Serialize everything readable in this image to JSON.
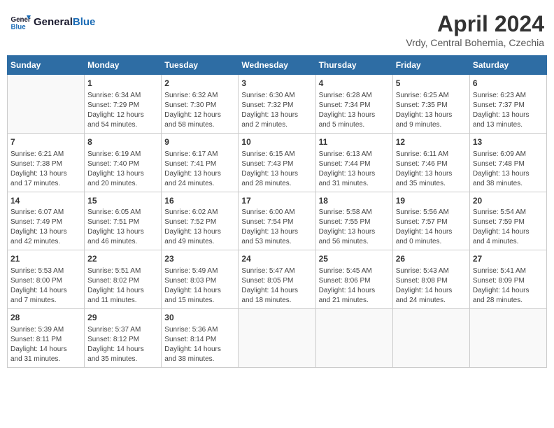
{
  "header": {
    "logo_line1": "General",
    "logo_line2": "Blue",
    "month": "April 2024",
    "location": "Vrdy, Central Bohemia, Czechia"
  },
  "days_of_week": [
    "Sunday",
    "Monday",
    "Tuesday",
    "Wednesday",
    "Thursday",
    "Friday",
    "Saturday"
  ],
  "weeks": [
    [
      {
        "num": "",
        "info": ""
      },
      {
        "num": "1",
        "info": "Sunrise: 6:34 AM\nSunset: 7:29 PM\nDaylight: 12 hours\nand 54 minutes."
      },
      {
        "num": "2",
        "info": "Sunrise: 6:32 AM\nSunset: 7:30 PM\nDaylight: 12 hours\nand 58 minutes."
      },
      {
        "num": "3",
        "info": "Sunrise: 6:30 AM\nSunset: 7:32 PM\nDaylight: 13 hours\nand 2 minutes."
      },
      {
        "num": "4",
        "info": "Sunrise: 6:28 AM\nSunset: 7:34 PM\nDaylight: 13 hours\nand 5 minutes."
      },
      {
        "num": "5",
        "info": "Sunrise: 6:25 AM\nSunset: 7:35 PM\nDaylight: 13 hours\nand 9 minutes."
      },
      {
        "num": "6",
        "info": "Sunrise: 6:23 AM\nSunset: 7:37 PM\nDaylight: 13 hours\nand 13 minutes."
      }
    ],
    [
      {
        "num": "7",
        "info": "Sunrise: 6:21 AM\nSunset: 7:38 PM\nDaylight: 13 hours\nand 17 minutes."
      },
      {
        "num": "8",
        "info": "Sunrise: 6:19 AM\nSunset: 7:40 PM\nDaylight: 13 hours\nand 20 minutes."
      },
      {
        "num": "9",
        "info": "Sunrise: 6:17 AM\nSunset: 7:41 PM\nDaylight: 13 hours\nand 24 minutes."
      },
      {
        "num": "10",
        "info": "Sunrise: 6:15 AM\nSunset: 7:43 PM\nDaylight: 13 hours\nand 28 minutes."
      },
      {
        "num": "11",
        "info": "Sunrise: 6:13 AM\nSunset: 7:44 PM\nDaylight: 13 hours\nand 31 minutes."
      },
      {
        "num": "12",
        "info": "Sunrise: 6:11 AM\nSunset: 7:46 PM\nDaylight: 13 hours\nand 35 minutes."
      },
      {
        "num": "13",
        "info": "Sunrise: 6:09 AM\nSunset: 7:48 PM\nDaylight: 13 hours\nand 38 minutes."
      }
    ],
    [
      {
        "num": "14",
        "info": "Sunrise: 6:07 AM\nSunset: 7:49 PM\nDaylight: 13 hours\nand 42 minutes."
      },
      {
        "num": "15",
        "info": "Sunrise: 6:05 AM\nSunset: 7:51 PM\nDaylight: 13 hours\nand 46 minutes."
      },
      {
        "num": "16",
        "info": "Sunrise: 6:02 AM\nSunset: 7:52 PM\nDaylight: 13 hours\nand 49 minutes."
      },
      {
        "num": "17",
        "info": "Sunrise: 6:00 AM\nSunset: 7:54 PM\nDaylight: 13 hours\nand 53 minutes."
      },
      {
        "num": "18",
        "info": "Sunrise: 5:58 AM\nSunset: 7:55 PM\nDaylight: 13 hours\nand 56 minutes."
      },
      {
        "num": "19",
        "info": "Sunrise: 5:56 AM\nSunset: 7:57 PM\nDaylight: 14 hours\nand 0 minutes."
      },
      {
        "num": "20",
        "info": "Sunrise: 5:54 AM\nSunset: 7:59 PM\nDaylight: 14 hours\nand 4 minutes."
      }
    ],
    [
      {
        "num": "21",
        "info": "Sunrise: 5:53 AM\nSunset: 8:00 PM\nDaylight: 14 hours\nand 7 minutes."
      },
      {
        "num": "22",
        "info": "Sunrise: 5:51 AM\nSunset: 8:02 PM\nDaylight: 14 hours\nand 11 minutes."
      },
      {
        "num": "23",
        "info": "Sunrise: 5:49 AM\nSunset: 8:03 PM\nDaylight: 14 hours\nand 15 minutes."
      },
      {
        "num": "24",
        "info": "Sunrise: 5:47 AM\nSunset: 8:05 PM\nDaylight: 14 hours\nand 18 minutes."
      },
      {
        "num": "25",
        "info": "Sunrise: 5:45 AM\nSunset: 8:06 PM\nDaylight: 14 hours\nand 21 minutes."
      },
      {
        "num": "26",
        "info": "Sunrise: 5:43 AM\nSunset: 8:08 PM\nDaylight: 14 hours\nand 24 minutes."
      },
      {
        "num": "27",
        "info": "Sunrise: 5:41 AM\nSunset: 8:09 PM\nDaylight: 14 hours\nand 28 minutes."
      }
    ],
    [
      {
        "num": "28",
        "info": "Sunrise: 5:39 AM\nSunset: 8:11 PM\nDaylight: 14 hours\nand 31 minutes."
      },
      {
        "num": "29",
        "info": "Sunrise: 5:37 AM\nSunset: 8:12 PM\nDaylight: 14 hours\nand 35 minutes."
      },
      {
        "num": "30",
        "info": "Sunrise: 5:36 AM\nSunset: 8:14 PM\nDaylight: 14 hours\nand 38 minutes."
      },
      {
        "num": "",
        "info": ""
      },
      {
        "num": "",
        "info": ""
      },
      {
        "num": "",
        "info": ""
      },
      {
        "num": "",
        "info": ""
      }
    ]
  ]
}
